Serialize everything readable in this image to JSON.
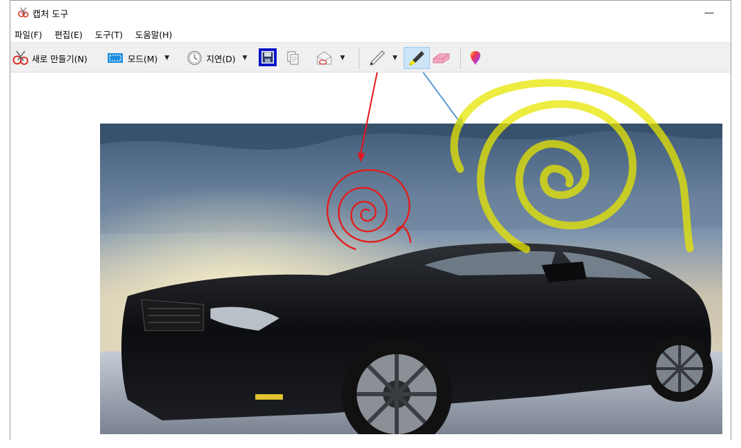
{
  "window": {
    "title": "캡처 도구",
    "minimize_glyph": "—"
  },
  "menu": {
    "items": [
      "파일(F)",
      "편집(E)",
      "도구(T)",
      "도움말(H)"
    ]
  },
  "toolbar": {
    "new_label": "새로 만들기(N)",
    "mode_label": "모드(M)",
    "delay_label": "지연(D)",
    "dropdown_glyph": "▼"
  },
  "colors": {
    "save_highlight": "#0a14c8",
    "arrow_pen": "#e8131b",
    "arrow_highlighter": "#5b9bd5",
    "pen_scribble": "#e21d1d",
    "highlighter_scribble": "#e7e600"
  },
  "icons": [
    "scissors-icon",
    "mode-rectangle-icon",
    "clock-icon",
    "save-icon",
    "copy-icon",
    "send-icon",
    "pen-icon",
    "highlighter-icon",
    "eraser-icon",
    "paint3d-icon"
  ]
}
